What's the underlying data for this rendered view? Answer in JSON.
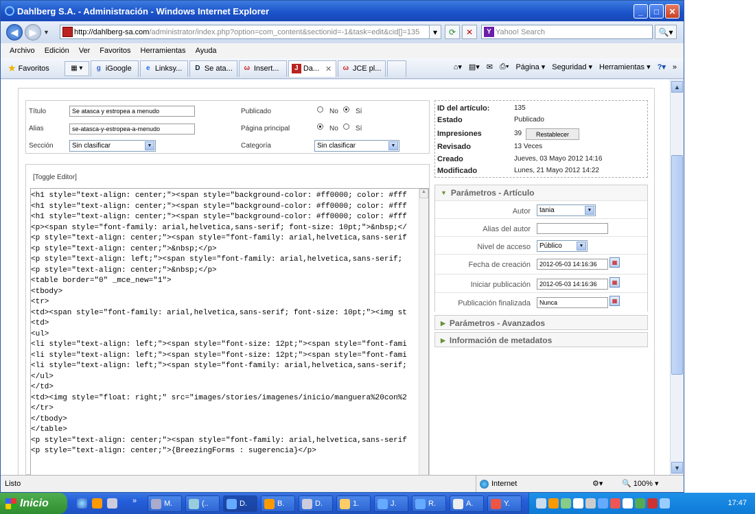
{
  "window": {
    "title": "Dahlberg S.A. - Administración - Windows Internet Explorer"
  },
  "address": {
    "url_domain": "http://dahlberg-sa.com",
    "url_path": "/administrator/index.php?option=com_content&sectionid=-1&task=edit&cid[]=135",
    "search_placeholder": "Yahoo! Search"
  },
  "menu": [
    "Archivo",
    "Edición",
    "Ver",
    "Favoritos",
    "Herramientas",
    "Ayuda"
  ],
  "favorites_label": "Favoritos",
  "tabs": [
    {
      "label": "iGoogle",
      "icon": "google-icon"
    },
    {
      "label": "Linksy...",
      "icon": "ie-icon"
    },
    {
      "label": "Se ata...",
      "icon": "d-icon"
    },
    {
      "label": "Insert...",
      "icon": "w-icon"
    },
    {
      "label": "Da...",
      "icon": "joomla-icon"
    },
    {
      "label": "JCE pl...",
      "icon": "w-icon"
    }
  ],
  "commands": {
    "pagina": "Página",
    "seguridad": "Seguridad",
    "herramientas": "Herramientas"
  },
  "form": {
    "titulo_label": "Título",
    "titulo_value": "Se atasca y estropea a menudo",
    "alias_label": "Alias",
    "alias_value": "se-atasca-y-estropea-a-menudo",
    "seccion_label": "Sección",
    "seccion_value": "Sin clasificar",
    "publicado_label": "Publicado",
    "pagina_label": "Página principal",
    "categoria_label": "Categoría",
    "categoria_value": "Sin clasificar",
    "no": "No",
    "si": "Sí"
  },
  "editor": {
    "toggle": "[Toggle Editor]",
    "lines": [
      "<h1 style=\"text-align: center;\"><span style=\"background-color: #ff0000; color: #fff",
      "<h1 style=\"text-align: center;\"><span style=\"background-color: #ff0000; color: #fff",
      "<h1 style=\"text-align: center;\"><span style=\"background-color: #ff0000; color: #fff",
      "<p><span style=\"font-family: arial,helvetica,sans-serif; font-size: 10pt;\">&nbsp;</",
      "<p style=\"text-align: center;\"><span style=\"font-family: arial,helvetica,sans-serif",
      "<p style=\"text-align: center;\">&nbsp;</p>",
      "<p style=\"text-align: left;\"><span style=\"font-family: arial,helvetica,sans-serif;",
      "<p style=\"text-align: center;\">&nbsp;</p>",
      "<table border=\"0\" _mce_new=\"1\">",
      "<tbody>",
      "<tr>",
      "<td><span style=\"font-family: arial,helvetica,sans-serif; font-size: 10pt;\"><img st",
      "<td>",
      "<ul>",
      "<li style=\"text-align: left;\"><span style=\"font-size: 12pt;\"><span style=\"font-fami",
      "<li style=\"text-align: left;\"><span style=\"font-size: 12pt;\"><span style=\"font-fami",
      "<li style=\"text-align: left;\"><span style=\"font-family: arial,helvetica,sans-serif;",
      "</ul>",
      "</td>",
      "<td><img style=\"float: right;\" src=\"images/stories/imagenes/inicio/manguera%20con%2",
      "</tr>",
      "</tbody>",
      "</table>",
      "<p style=\"text-align: center;\"><span style=\"font-family: arial,helvetica,sans-serif",
      "<p style=\"text-align: center;\">{BreezingForms : sugerencia}</p>"
    ]
  },
  "info": {
    "id_label": "ID del artículo:",
    "id_value": "135",
    "estado_label": "Estado",
    "estado_value": "Publicado",
    "impresiones_label": "Impresiones",
    "impresiones_value": "39",
    "restablecer": "Restablecer",
    "revisado_label": "Revisado",
    "revisado_value": "13 Veces",
    "creado_label": "Creado",
    "creado_value": "Jueves, 03 Mayo 2012 14:16",
    "modificado_label": "Modificado",
    "modificado_value": "Lunes, 21 Mayo 2012 14:22"
  },
  "params": {
    "title": "Parámetros - Artículo",
    "autor_label": "Autor",
    "autor_value": "tania",
    "alias_autor_label": "Alias del autor",
    "nivel_label": "Nivel de acceso",
    "nivel_value": "Público",
    "fecha_label": "Fecha de creación",
    "fecha_value": "2012-05-03 14:16:36",
    "iniciar_label": "Iniciar publicación",
    "iniciar_value": "2012-05-03 14:16:36",
    "final_label": "Publicación finalizada",
    "final_value": "Nunca"
  },
  "panels": {
    "avanzados": "Parámetros - Avanzados",
    "metadatos": "Información de metadatos"
  },
  "status": {
    "text": "Listo",
    "zone": "Internet",
    "zoom": "100%"
  },
  "taskbar": {
    "start": "Inicio",
    "buttons": [
      "M.",
      "(..",
      "D.",
      "B.",
      "D.",
      "1.",
      "J.",
      "R.",
      "A.",
      "Y."
    ],
    "clock": "17:47"
  },
  "colors": {
    "titlebar": "#1a52c8",
    "taskbar": "#245edb",
    "start": "#2f8d2f"
  }
}
